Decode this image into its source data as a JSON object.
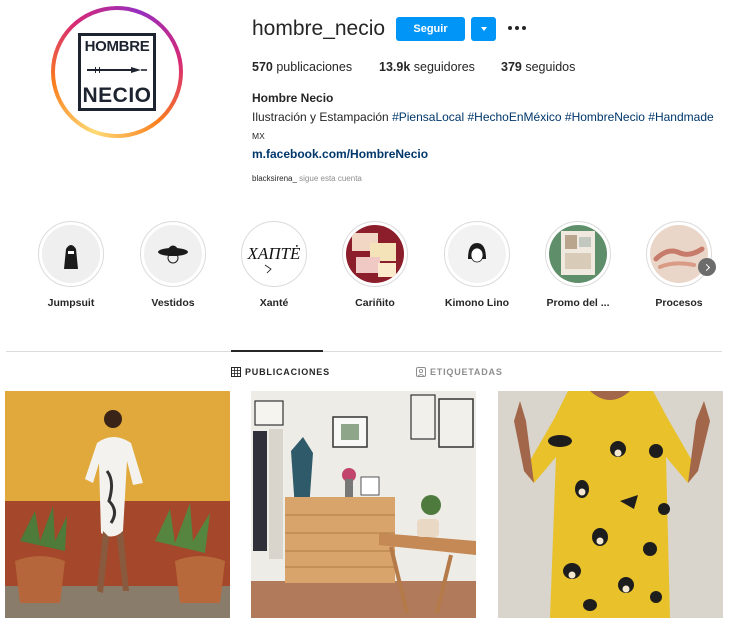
{
  "profile": {
    "username": "hombre_necio",
    "follow_label": "Seguir",
    "logo_line1": "HOMBRE",
    "logo_line2": "NECIO",
    "stats": {
      "posts_count": "570",
      "posts_label": "publicaciones",
      "followers_count": "13.9k",
      "followers_label": "seguidores",
      "following_count": "379",
      "following_label": "seguidos"
    },
    "full_name": "Hombre Necio",
    "bio_text": "Ilustración y Estampación",
    "hashtags": [
      "#PiensaLocal",
      "#HechoEnMéxico",
      "#HombreNecio",
      "#Handmade"
    ],
    "country": "MX",
    "link": "m.facebook.com/HombreNecio",
    "followed_by_user": "blacksirena_",
    "followed_by_text": "sigue esta cuenta"
  },
  "highlights": [
    {
      "label": "Jumpsuit",
      "icon": "hoodie-figure"
    },
    {
      "label": "Vestidos",
      "icon": "hat-figure"
    },
    {
      "label": "Xanté",
      "icon": "xante-logo"
    },
    {
      "label": "Cariñito",
      "icon": "cards"
    },
    {
      "label": "Kimono Lino",
      "icon": "woman-portrait"
    },
    {
      "label": "Promo del ...",
      "icon": "photo-collage"
    },
    {
      "label": "Procesos",
      "icon": "hands-sketch"
    }
  ],
  "tabs": {
    "posts_label": "PUBLICACIONES",
    "tagged_label": "ETIQUETADAS"
  },
  "colors": {
    "accent": "#0095f6",
    "link": "#00376b",
    "muted": "#8e8e8e"
  }
}
